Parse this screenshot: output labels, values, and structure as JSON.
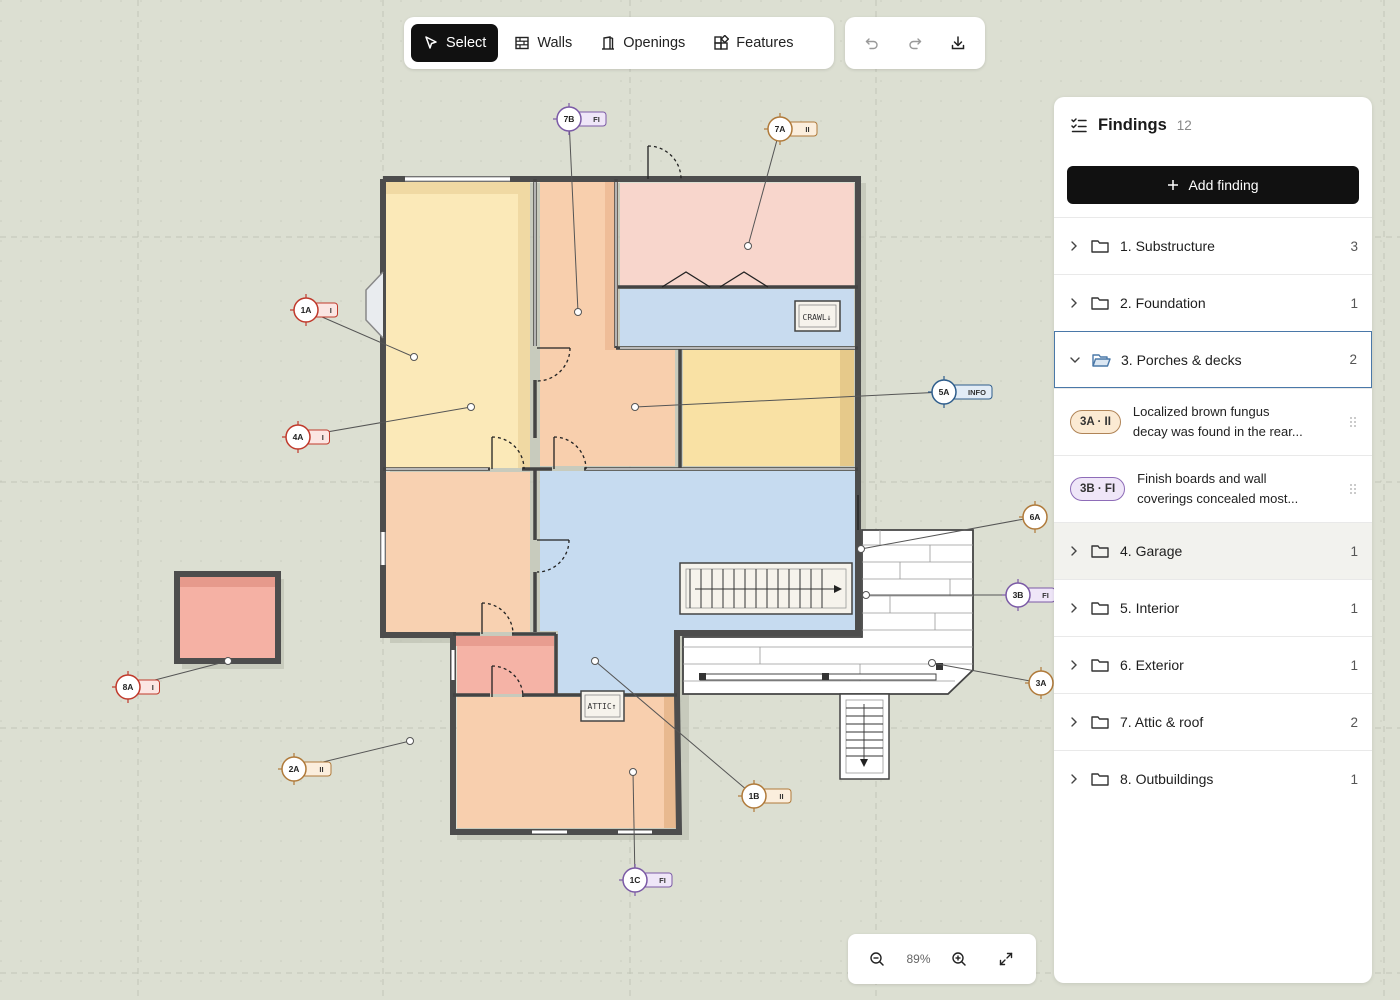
{
  "toolbar": {
    "tools": [
      {
        "label": "Select",
        "icon": "cursor-icon",
        "active": true
      },
      {
        "label": "Walls",
        "icon": "walls-icon",
        "active": false
      },
      {
        "label": "Openings",
        "icon": "door-icon",
        "active": false
      },
      {
        "label": "Features",
        "icon": "features-icon",
        "active": false
      }
    ],
    "actions": [
      "undo-icon",
      "redo-icon",
      "download-icon"
    ]
  },
  "zoom": {
    "value": "89%"
  },
  "panel": {
    "title": "Findings",
    "count": "12",
    "add_label": "Add finding",
    "categories": [
      {
        "label": "1. Substructure",
        "count": "3"
      },
      {
        "label": "2. Foundation",
        "count": "1"
      },
      {
        "label": "3. Porches & decks",
        "count": "2",
        "expanded": true
      },
      {
        "label": "4. Garage",
        "count": "1"
      },
      {
        "label": "5. Interior",
        "count": "1"
      },
      {
        "label": "6. Exterior",
        "count": "1"
      },
      {
        "label": "7. Attic & roof",
        "count": "2"
      },
      {
        "label": "8. Outbuildings",
        "count": "1"
      }
    ],
    "findings": [
      {
        "badge": "3A · II",
        "severity": "II",
        "line1": "Localized brown fungus",
        "line2": "decay was found in the rear..."
      },
      {
        "badge": "3B · FI",
        "severity": "FI",
        "line1": "Finish boards and wall",
        "line2": "coverings concealed most..."
      }
    ]
  },
  "plan": {
    "labels": {
      "crawl": "CRAWL↓",
      "attic": "ATTIC↑"
    },
    "markers": [
      {
        "id": "7B",
        "sev": "FI"
      },
      {
        "id": "7A",
        "sev": "II"
      },
      {
        "id": "1A",
        "sev": "I"
      },
      {
        "id": "4A",
        "sev": "I"
      },
      {
        "id": "5A",
        "sev": "INFO"
      },
      {
        "id": "6A",
        "sev": ""
      },
      {
        "id": "3B",
        "sev": "FI"
      },
      {
        "id": "3A",
        "sev": ""
      },
      {
        "id": "8A",
        "sev": "I"
      },
      {
        "id": "2A",
        "sev": "II"
      },
      {
        "id": "1B",
        "sev": "II"
      },
      {
        "id": "1C",
        "sev": "FI"
      }
    ]
  },
  "colors": {
    "sev_I": "#c0392b",
    "sev_II": "#b07a3a",
    "sev_FI": "#7b5aa6",
    "sev_INFO": "#2e5d8c",
    "wall": "#4d4d4d",
    "accent": "#4a78a8"
  }
}
